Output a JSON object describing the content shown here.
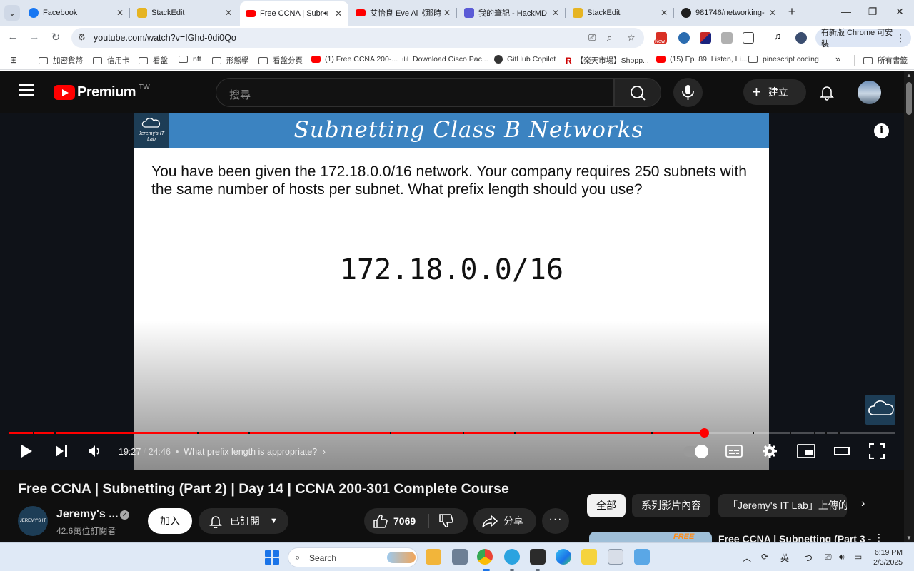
{
  "browser": {
    "tabs": [
      {
        "title": "Facebook",
        "favicon_color": "#1877f2",
        "active": false
      },
      {
        "title": "StackEdit",
        "favicon_color": "#e6b422",
        "active": false
      },
      {
        "title": "Free CCNA | Subn",
        "favicon_color": "#ff0000",
        "active": true
      },
      {
        "title": "艾怡良 Eve Ai《那時",
        "favicon_color": "#ff0000",
        "active": false
      },
      {
        "title": "我的筆記 - HackMD",
        "favicon_color": "#5b5bd6",
        "active": false
      },
      {
        "title": "StackEdit",
        "favicon_color": "#e6b422",
        "active": false
      },
      {
        "title": "981746/networking-",
        "favicon_color": "#1f1f1f",
        "active": false
      }
    ],
    "url": "youtube.com/watch?v=IGhd-0di0Qo",
    "update_label": "有新版 Chrome 可安裝",
    "new_badge": "New",
    "bookmarks": [
      {
        "label": "加密貨幣",
        "type": "folder"
      },
      {
        "label": "信用卡",
        "type": "folder"
      },
      {
        "label": "看盤",
        "type": "folder"
      },
      {
        "label": "nft",
        "type": "folder"
      },
      {
        "label": "形態學",
        "type": "folder"
      },
      {
        "label": "看盤分頁",
        "type": "folder"
      },
      {
        "label": "(1) Free CCNA 200-...",
        "type": "youtube"
      },
      {
        "label": "Download Cisco Pac...",
        "type": "cisco"
      },
      {
        "label": "GitHub Copilot",
        "type": "github"
      },
      {
        "label": "【楽天市場】Shopp...",
        "type": "rakuten"
      },
      {
        "label": "(15) Ep. 89, Listen, Li...",
        "type": "youtube"
      },
      {
        "label": "pinescript coding",
        "type": "folder"
      }
    ],
    "bookmarks_more": "»",
    "all_bookmarks": "所有書籤"
  },
  "youtube": {
    "logo_word": "Premium",
    "country_code": "TW",
    "search_placeholder": "搜尋",
    "create_label": "建立",
    "video": {
      "slide_title": "Subnetting Class B Networks",
      "slide_logo": "Jeremy's IT Lab",
      "slide_question": "You have been given the 172.18.0.0/16 network.  Your company requires 250 subnets with the same number of hosts per subnet.  What prefix length should you use?",
      "slide_network": "172.18.0.0/16",
      "current_time": "19:27",
      "duration": "24:46",
      "chapter": "What prefix length is appropriate?",
      "progress_fraction": 0.7851
    },
    "title": "Free CCNA | Subnetting (Part 2) | Day 14 | CCNA 200-301 Complete Course",
    "channel": {
      "name": "Jeremy's ...",
      "subscribers": "42.6萬位訂閱者",
      "avatar_text": "JEREMY'S IT LAB"
    },
    "join_label": "加入",
    "subscribed_label": "已訂閱",
    "like_count": "7069",
    "share_label": "分享",
    "chips": [
      {
        "label": "全部",
        "selected": true
      },
      {
        "label": "系列影片內容",
        "selected": false
      },
      {
        "label": "「Jeremy's IT Lab」上傳的",
        "selected": false
      }
    ],
    "recommended": {
      "title": "Free CCNA | Subnetting (Part 3 -",
      "thumb_text": "FREE"
    }
  },
  "taskbar": {
    "search_label": "Search",
    "ime_label": "英",
    "time": "6:19 PM",
    "date": "2/3/2025"
  }
}
